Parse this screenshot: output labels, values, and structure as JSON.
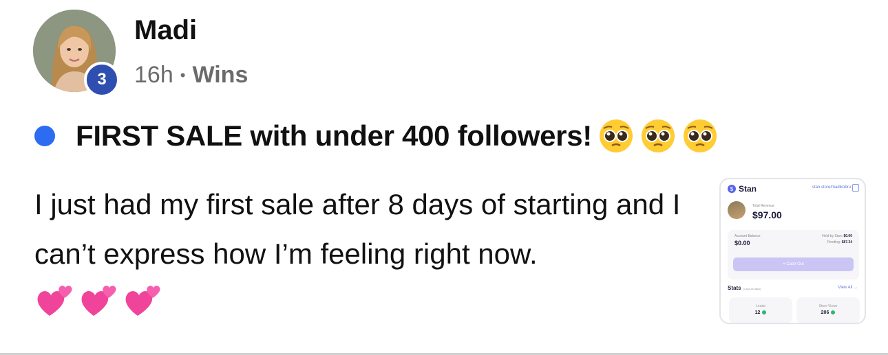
{
  "post": {
    "author": {
      "name": "Madi",
      "level": "3"
    },
    "meta": {
      "time": "16h",
      "separator": "•",
      "category": "Wins"
    },
    "title": "FIRST SALE with under 400 followers!",
    "title_emojis": [
      "pleading-face",
      "pleading-face",
      "pleading-face"
    ],
    "body": "I just had my first sale after 8 days of starting and I can’t express how I’m feeling right now.",
    "body_emojis": [
      "two-hearts",
      "two-hearts",
      "two-hearts"
    ],
    "unread_color": "#2d6cf0"
  },
  "attachment": {
    "brand": "Stan",
    "store_url": "stan.store/madikobru",
    "total_revenue_label": "Total Revenue",
    "total_revenue": "$97.00",
    "account_balance_label": "Account Balance",
    "account_balance": "$0.00",
    "held_label": "Held by Stan:",
    "held_value": "$0.00",
    "pending_label": "Pending:",
    "pending_value": "$87.34",
    "cash_out_label": "+ Cash Out",
    "stats_label": "Stats",
    "stats_sub": "(Last 28 days)",
    "view_all_label": "View All →",
    "leads_label": "Leads",
    "leads_value": "12",
    "store_views_label": "Store Views",
    "store_views_value": "206"
  },
  "colors": {
    "badge": "#2f4fb0",
    "accent": "#2d6cf0",
    "meta_text": "#6b6b6b"
  }
}
